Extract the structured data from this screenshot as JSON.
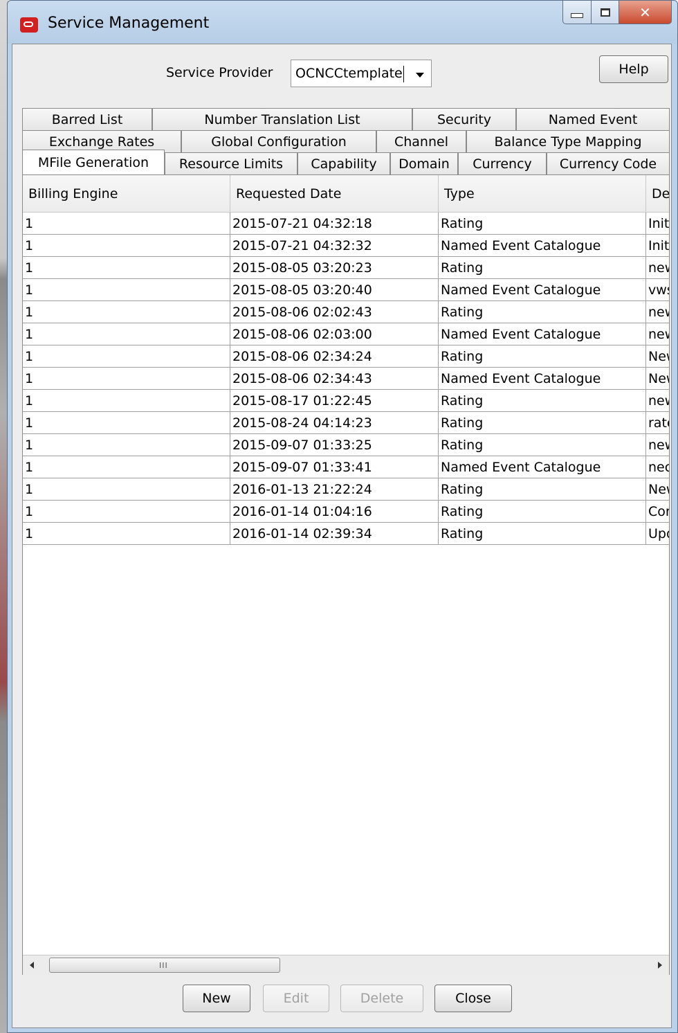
{
  "window": {
    "title": "Service Management"
  },
  "service_provider": {
    "label": "Service Provider",
    "value": "OCNCCtemplate"
  },
  "help_label": "Help",
  "tabs": {
    "row1": [
      "Barred List",
      "Number Translation List",
      "Security",
      "Named Event"
    ],
    "row2": [
      "Exchange Rates",
      "Global Configuration",
      "Channel",
      "Balance Type Mapping"
    ],
    "row3": [
      "MFile Generation",
      "Resource Limits",
      "Capability",
      "Domain",
      "Currency",
      "Currency Code"
    ],
    "active": "MFile Generation"
  },
  "table": {
    "columns": [
      "Billing Engine",
      "Requested Date",
      "Type",
      "Des"
    ],
    "rows": [
      [
        "1",
        "2015-07-21 04:32:18",
        "Rating",
        "Initi"
      ],
      [
        "1",
        "2015-07-21 04:32:32",
        "Named Event Catalogue",
        "Initi"
      ],
      [
        "1",
        "2015-08-05 03:20:23",
        "Rating",
        "new"
      ],
      [
        "1",
        "2015-08-05 03:20:40",
        "Named Event Catalogue",
        "vws"
      ],
      [
        "1",
        "2015-08-06 02:02:43",
        "Rating",
        "new"
      ],
      [
        "1",
        "2015-08-06 02:03:00",
        "Named Event Catalogue",
        "new"
      ],
      [
        "1",
        "2015-08-06 02:34:24",
        "Rating",
        "New"
      ],
      [
        "1",
        "2015-08-06 02:34:43",
        "Named Event Catalogue",
        "New"
      ],
      [
        "1",
        "2015-08-17 01:22:45",
        "Rating",
        "new"
      ],
      [
        "1",
        "2015-08-24 04:14:23",
        "Rating",
        "rate"
      ],
      [
        "1",
        "2015-09-07 01:33:25",
        "Rating",
        "new"
      ],
      [
        "1",
        "2015-09-07 01:33:41",
        "Named Event Catalogue",
        "nec"
      ],
      [
        "1",
        "2016-01-13 21:22:24",
        "Rating",
        "New"
      ],
      [
        "1",
        "2016-01-14 01:04:16",
        "Rating",
        "Cor"
      ],
      [
        "1",
        "2016-01-14 02:39:34",
        "Rating",
        "Upd"
      ]
    ]
  },
  "scrollbar": {
    "grip": "III"
  },
  "buttons": {
    "new": "New",
    "edit": "Edit",
    "delete": "Delete",
    "close": "Close"
  },
  "colors": {
    "window_frame": "#b9d1ea",
    "close_button": "#c94a2e",
    "logo": "#d02020",
    "panel": "#ededed"
  },
  "icons": {
    "app": "oracle-logo-icon",
    "minimize": "minimize-icon",
    "maximize": "maximize-icon",
    "close": "close-icon",
    "dropdown": "chevron-down-icon"
  }
}
